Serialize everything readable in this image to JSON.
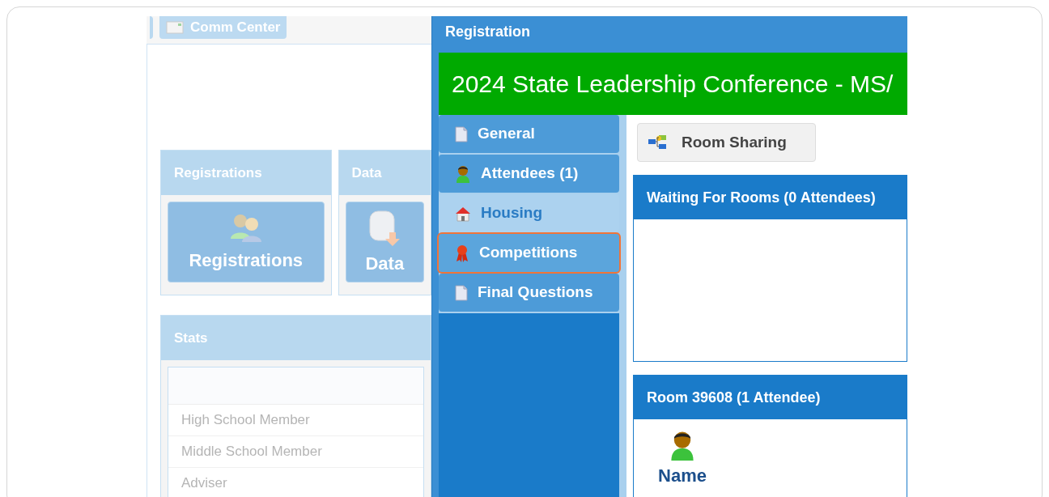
{
  "background": {
    "top_buttons": [
      {
        "label": "Comm Center"
      }
    ],
    "panels": [
      {
        "title": "Registrations",
        "tile": "Registrations",
        "kind": "people"
      },
      {
        "title": "Data",
        "tile": "Data",
        "kind": "database"
      }
    ],
    "stats": {
      "title": "Stats",
      "rows": [
        "High School Member",
        "Middle School Member",
        "Adviser"
      ]
    }
  },
  "dialog": {
    "title": "Registration",
    "banner": "2024 State Leadership Conference - MS/",
    "tabs": [
      {
        "label": "General",
        "kind": "page",
        "selected": false,
        "highlighted": false
      },
      {
        "label": "Attendees (1)",
        "kind": "person",
        "selected": false,
        "highlighted": false
      },
      {
        "label": "Housing",
        "kind": "house",
        "selected": true,
        "highlighted": false
      },
      {
        "label": "Competitions",
        "kind": "ribbon",
        "selected": false,
        "highlighted": true
      },
      {
        "label": "Final Questions",
        "kind": "page",
        "selected": false,
        "highlighted": false
      }
    ],
    "toolbar_button": "Room Sharing",
    "sections": [
      {
        "title": "Waiting For Rooms (0 Attendees)",
        "kind": "empty"
      },
      {
        "title": "Room 39608 (1 Attendee)",
        "kind": "attendees",
        "attendee_label": "Name"
      }
    ]
  }
}
